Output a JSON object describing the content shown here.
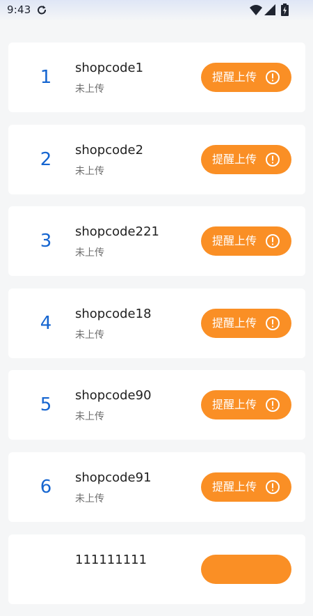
{
  "status_bar": {
    "time": "9:43",
    "icons": [
      "sync-icon",
      "wifi-icon",
      "signal-icon",
      "battery-icon"
    ]
  },
  "colors": {
    "accent_orange": "#fa8f25",
    "index_blue": "#1565d0",
    "card_bg": "#ffffff",
    "page_bg": "#f5f6f7"
  },
  "shops": [
    {
      "index": "1",
      "code": "shopcode1",
      "status": "未上传",
      "button_label": "提醒上传"
    },
    {
      "index": "2",
      "code": "shopcode2",
      "status": "未上传",
      "button_label": "提醒上传"
    },
    {
      "index": "3",
      "code": "shopcode221",
      "status": "未上传",
      "button_label": "提醒上传"
    },
    {
      "index": "4",
      "code": "shopcode18",
      "status": "未上传",
      "button_label": "提醒上传"
    },
    {
      "index": "5",
      "code": "shopcode90",
      "status": "未上传",
      "button_label": "提醒上传"
    },
    {
      "index": "6",
      "code": "shopcode91",
      "status": "未上传",
      "button_label": "提醒上传"
    },
    {
      "index": "",
      "code": "111111111",
      "status": "",
      "button_label": ""
    }
  ]
}
